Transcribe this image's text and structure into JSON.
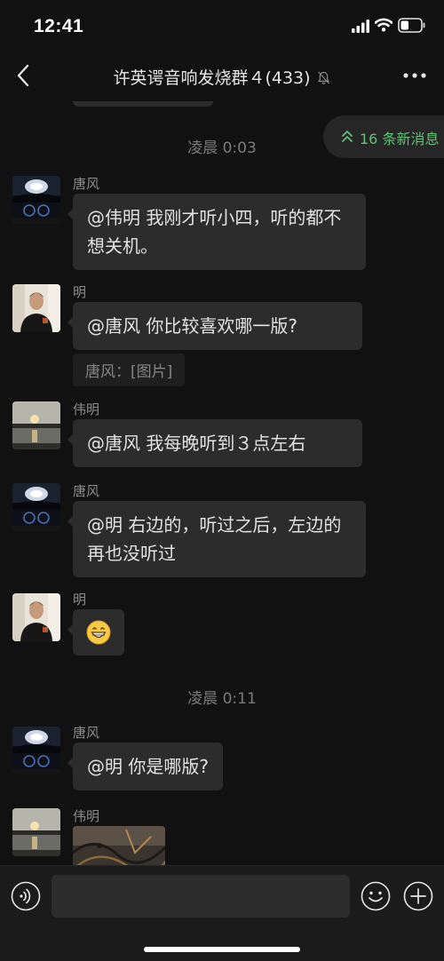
{
  "status_bar": {
    "time": "12:41"
  },
  "header": {
    "title": "许英谔音响发烧群４(433)"
  },
  "new_messages": {
    "label": "16 条新消息"
  },
  "timestamps": [
    "凌晨 0:03",
    "凌晨 0:11"
  ],
  "messages": [
    {
      "sender": "唐风",
      "avatar": "car-dashboard-night",
      "text": "@伟明 我刚才听小四，听的都不想关机。"
    },
    {
      "sender": "明",
      "avatar": "man-in-black-shirt",
      "text": "@唐风 你比较喜欢哪一版?",
      "quote": "唐风：[图片]"
    },
    {
      "sender": "伟明",
      "avatar": "sunset-over-water",
      "text": "@唐风 我每晚听到３点左右"
    },
    {
      "sender": "唐风",
      "avatar": "car-dashboard-night",
      "text": "@明 右边的，听过之后，左边的再也没听过"
    },
    {
      "sender": "明",
      "avatar": "man-in-black-shirt",
      "emoji": "grinning-face-emoji"
    },
    {
      "sender": "唐风",
      "avatar": "car-dashboard-night",
      "text": "@明 你是哪版?"
    },
    {
      "sender": "伟明",
      "avatar": "sunset-over-water",
      "image": "photo-cables"
    }
  ],
  "input": {
    "value": "",
    "placeholder": ""
  },
  "icons": {
    "back": "chevron-left-icon",
    "mute": "bell-muted-icon",
    "more": "ellipsis-icon",
    "voice": "voice-icon",
    "emoji": "smiley-icon",
    "plus": "plus-icon"
  },
  "colors": {
    "background": "#111111",
    "bubble": "#2c2c2c",
    "accent_green": "#5fc277",
    "text": "#e2e2e2",
    "muted_text": "#7a7a7a"
  }
}
